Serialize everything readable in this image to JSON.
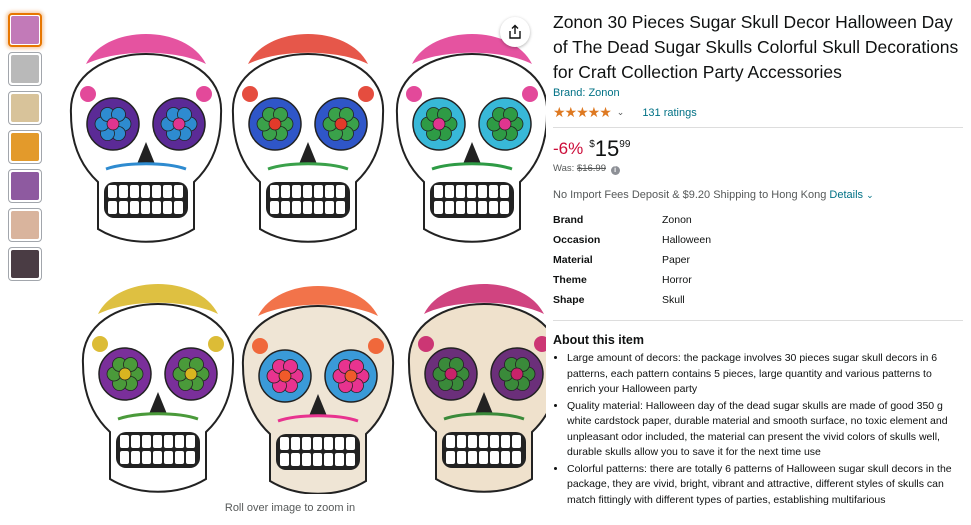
{
  "thumbnails": [
    {
      "name": "thumb-1",
      "color": "#c27ab8",
      "active": true
    },
    {
      "name": "thumb-2",
      "color": "#b9b9b9",
      "active": false
    },
    {
      "name": "thumb-3",
      "color": "#d8c39a",
      "active": false
    },
    {
      "name": "thumb-4",
      "color": "#e39a2b",
      "active": false
    },
    {
      "name": "thumb-5",
      "color": "#8e5aa0",
      "active": false
    },
    {
      "name": "thumb-6",
      "color": "#d9b49d",
      "active": false
    },
    {
      "name": "thumb-7",
      "color": "#4a3c44",
      "active": false
    }
  ],
  "image": {
    "zoom_hint": "Roll over image to zoom in",
    "share_icon": "share-icon"
  },
  "product": {
    "title": "Zonon 30 Pieces Sugar Skull Decor Halloween Day of The Dead Sugar Skulls Colorful Skull Decorations for Craft Collection Party Accessories",
    "brand_link": "Brand: Zonon",
    "stars": "★★★★★",
    "rating_value": 4.5,
    "ratings_count": "131 ratings",
    "discount": "-6%",
    "currency": "$",
    "price_whole": "15",
    "price_fraction": "99",
    "was_label": "Was:",
    "was_price": "$16.99",
    "shipping_text": "No Import Fees Deposit & $9.20 Shipping to Hong Kong",
    "shipping_details": "Details"
  },
  "specs": [
    {
      "key": "Brand",
      "value": "Zonon"
    },
    {
      "key": "Occasion",
      "value": "Halloween"
    },
    {
      "key": "Material",
      "value": "Paper"
    },
    {
      "key": "Theme",
      "value": "Horror"
    },
    {
      "key": "Shape",
      "value": "Skull"
    }
  ],
  "about": {
    "title": "About this item",
    "bullets": [
      "Large amount of decors: the package involves 30 pieces sugar skull decors in 6 patterns, each pattern contains 5 pieces, large quantity and various patterns to enrich your Halloween party",
      "Quality material: Halloween day of the dead sugar skulls are made of good 350 g white cardstock paper, durable material and smooth surface, no toxic element and unpleasant odor included, the material can present the vivid colors of skulls well, durable skulls allow you to save it for the next time use",
      "Colorful patterns: there are totally 6 patterns of Halloween sugar skull decors in the package, they are vivid, bright, vibrant and attractive, different styles of skulls can match fittingly with different types of parties, establishing multifarious"
    ]
  },
  "colors": {
    "link": "#007185",
    "discount": "#cc0c39",
    "star": "#de7921",
    "thumb_active_border": "#e77600"
  }
}
